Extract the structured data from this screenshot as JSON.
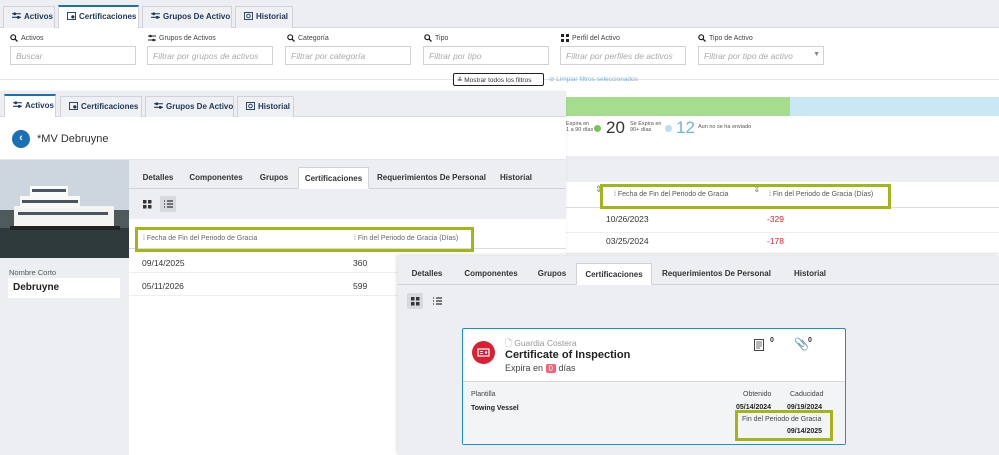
{
  "top_tabs": [
    "Activos",
    "Certificaciones",
    "Grupos De Activo",
    "Historial"
  ],
  "filters": {
    "activos": {
      "label": "Activos",
      "placeholder": "Buscar"
    },
    "grupos": {
      "label": "Grupos de Activos",
      "placeholder": "Filtrar por grupos de activos"
    },
    "categoria": {
      "label": "Categoría",
      "placeholder": "Filtrar por categoría"
    },
    "tipo": {
      "label": "Tipo",
      "placeholder": "Filtrar por tipo"
    },
    "perfil": {
      "label": "Perfil del Activo",
      "placeholder": "Filtrar por perfiles de activos"
    },
    "tipo_activo": {
      "label": "Tipo de Activo",
      "placeholder": "Filtrar por tipo de activo"
    },
    "show_all": "Mostrar todos los filtros",
    "clear": "Limpiar filtros seleccionados"
  },
  "summary": {
    "expira_a_90": "Expira en\n1 a 90 días",
    "count_20": "20",
    "expira_90plus": "Se Expira en\n90+ días",
    "count_12": "12",
    "not_sent": "Aun no se ha enviado"
  },
  "bg_table": {
    "headers": [
      "Fecha de Fin del Periodo de Gracia",
      "Fin del Periodo de Gracia (Días)"
    ],
    "rows": [
      {
        "fecha": "10/26/2023",
        "dias": "-329"
      },
      {
        "fecha": "03/25/2024",
        "dias": "-178"
      }
    ]
  },
  "panel1": {
    "tabs": [
      "Activos",
      "Certificaciones",
      "Grupos De Activo",
      "Historial"
    ],
    "title": "*MV Debruyne",
    "nombre_corto_label": "Nombre Corto",
    "nombre_corto_value": "Debruyne",
    "subtabs": [
      "Detalles",
      "Componentes",
      "Grupos",
      "Certificaciones",
      "Requerimientos De Personal",
      "Historial"
    ],
    "headers": [
      "Fecha de Fin del Periodo de Gracia",
      "Fin del Periodo de Gracia (Días)"
    ],
    "rows": [
      {
        "fecha": "09/14/2025",
        "dias": "360"
      },
      {
        "fecha": "05/11/2026",
        "dias": "599"
      }
    ]
  },
  "panel2": {
    "subtabs": [
      "Detalles",
      "Componentes",
      "Grupos",
      "Certificaciones",
      "Requerimientos De Personal",
      "Historial"
    ],
    "card": {
      "issuer": "Guardia Costera",
      "title": "Certificate of Inspection",
      "expira_prefix": "Expira en",
      "expira_days": "0",
      "expira_suffix": "días",
      "doc_count": "0",
      "attach_count": "0",
      "plantilla_label": "Plantilla",
      "plantilla_value": "Towing Vessel",
      "obtenido_label": "Obtenido",
      "obtenido_value": "05/14/2024",
      "caducidad_label": "Caducidad",
      "caducidad_value": "09/19/2024",
      "fin_label": "Fin del Periodo de Gracia",
      "fin_value": "09/14/2025"
    }
  },
  "colors": {
    "accent": "#1a6fb5",
    "highlight": "#a3b51a",
    "negative": "#e0242e",
    "green": "#a6dc8e",
    "blue": "#c8e9f4",
    "cert_red": "#d92032"
  }
}
